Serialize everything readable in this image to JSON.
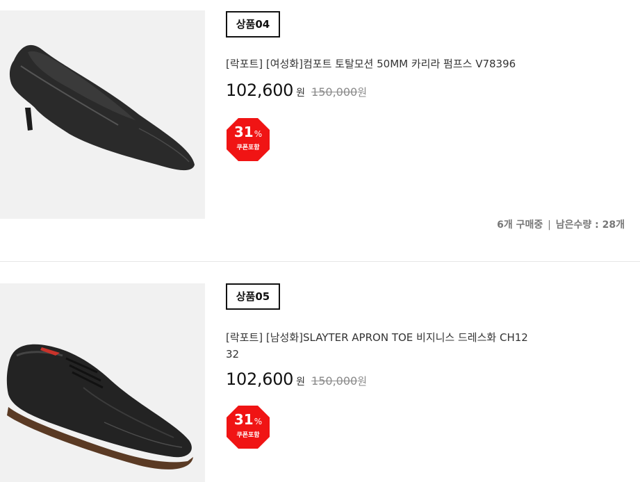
{
  "products": [
    {
      "badge": "상품04",
      "title": "[락포트] [여성화]컴포트 토탈모션 50MM 카리라 펌프스 V78396",
      "sale_price": "102,600",
      "sale_unit": "원",
      "original_price": "150,000",
      "original_unit": "원",
      "discount_value": "31",
      "discount_symbol": "%",
      "discount_label": "쿠폰포함",
      "buying_count": "6개 구매중",
      "separator": "|",
      "remaining": "남은수량 : 28개",
      "image": "black-leather-pump-heel"
    },
    {
      "badge": "상품05",
      "title": "[락포트] [남성화]SLAYTER APRON TOE 비지니스 드레스화 CH1232",
      "sale_price": "102,600",
      "sale_unit": "원",
      "original_price": "150,000",
      "original_unit": "원",
      "discount_value": "31",
      "discount_symbol": "%",
      "discount_label": "쿠폰포함",
      "image": "black-leather-oxford-shoe"
    }
  ],
  "colors": {
    "discount_badge": "#f01414",
    "thumb_background": "#f1f1f1"
  }
}
